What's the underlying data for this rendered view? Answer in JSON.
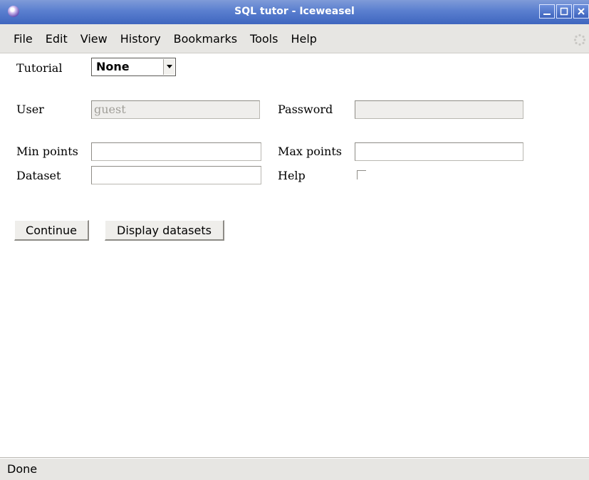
{
  "window": {
    "title": "SQL tutor - Iceweasel"
  },
  "menubar": {
    "items": [
      "File",
      "Edit",
      "View",
      "History",
      "Bookmarks",
      "Tools",
      "Help"
    ]
  },
  "form": {
    "tutorial_label": "Tutorial",
    "tutorial_value": "None",
    "user_label": "User",
    "user_value": "guest",
    "password_label": "Password",
    "password_value": "",
    "min_points_label": "Min points",
    "min_points_value": "",
    "max_points_label": "Max points",
    "max_points_value": "",
    "dataset_label": "Dataset",
    "dataset_value": "",
    "help_label": "Help",
    "help_checked": false
  },
  "buttons": {
    "continue": "Continue",
    "display_datasets": "Display datasets"
  },
  "statusbar": {
    "text": "Done"
  },
  "colors": {
    "titlebar": "#5a7fcf",
    "chrome": "#e7e6e3"
  }
}
